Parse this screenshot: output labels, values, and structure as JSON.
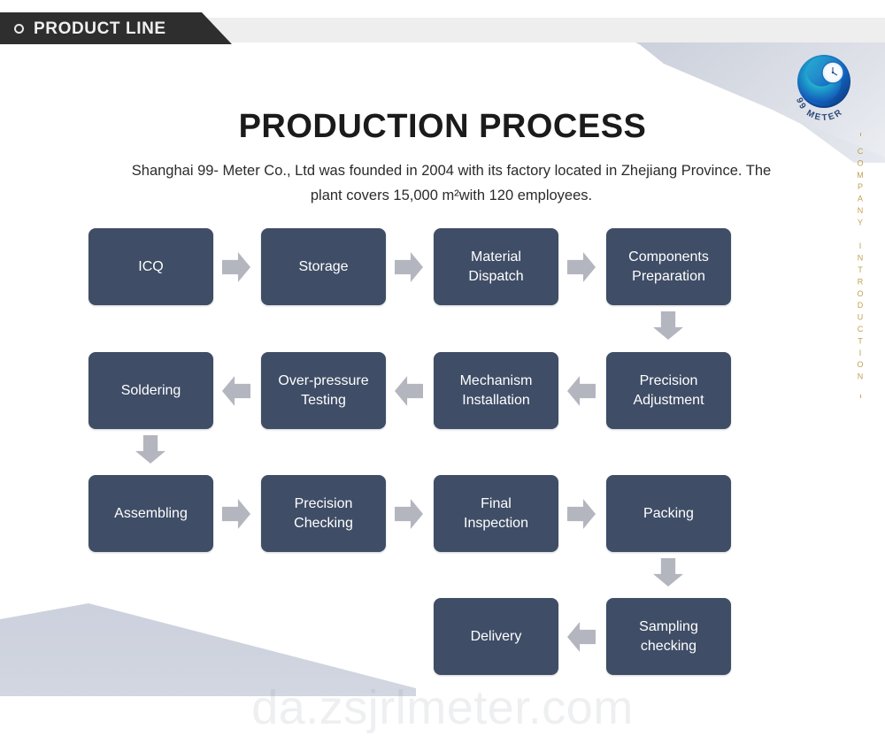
{
  "header": {
    "tab_label": "PRODUCT LINE",
    "bullet_icon": "circle-outline-icon"
  },
  "logo": {
    "name": "99-meter-logo",
    "brand_text": "99 METER",
    "colors": {
      "outer": "#1b63c4",
      "mid": "#1ea5c8",
      "inner": "#0e3f8f",
      "highlight": "#6fd8e6"
    }
  },
  "side_rail": {
    "vertical_text": "COMPANY INTRODUCTION",
    "color": "#c2a052"
  },
  "page_title": "PRODUCTION PROCESS",
  "subtitle": "Shanghai 99- Meter Co., Ltd was founded in 2004 with its factory located in Zhejiang Province. The plant covers 15,000 m²with 120 employees.",
  "colors": {
    "box_fill": "#3f4d66",
    "arrow_fill": "#b3b6bf",
    "header_dark": "#2e2e2e",
    "header_strip": "#eeeeee",
    "deco_blue_gray": "#ccd1dd",
    "accent_gold": "#c2a052"
  },
  "flow": {
    "rows": [
      {
        "direction": "right",
        "steps": [
          {
            "label": "ICQ"
          },
          {
            "label": "Storage"
          },
          {
            "label": "Material\nDispatch"
          },
          {
            "label": "Components\nPreparation"
          }
        ]
      },
      {
        "direction": "left",
        "steps": [
          {
            "label": "Soldering"
          },
          {
            "label": "Over-pressure\nTesting"
          },
          {
            "label": "Mechanism\nInstallation"
          },
          {
            "label": "Precision\nAdjustment"
          }
        ]
      },
      {
        "direction": "right",
        "steps": [
          {
            "label": "Assembling"
          },
          {
            "label": "Precision\nChecking"
          },
          {
            "label": "Final\nInspection"
          },
          {
            "label": "Packing"
          }
        ]
      },
      {
        "direction": "left",
        "steps": [
          {
            "label": "Delivery"
          },
          {
            "label": "Sampling\nchecking"
          }
        ]
      }
    ],
    "connectors": [
      {
        "name": "arrow-icq-to-storage",
        "type": "arrow-right"
      },
      {
        "name": "arrow-storage-to-material-dispatch",
        "type": "arrow-right"
      },
      {
        "name": "arrow-material-dispatch-to-components-preparation",
        "type": "arrow-right"
      },
      {
        "name": "arrow-components-preparation-to-precision-adjustment",
        "type": "arrow-down"
      },
      {
        "name": "arrow-precision-adjustment-to-mechanism-installation",
        "type": "arrow-left"
      },
      {
        "name": "arrow-mechanism-installation-to-over-pressure-testing",
        "type": "arrow-left"
      },
      {
        "name": "arrow-over-pressure-testing-to-soldering",
        "type": "arrow-left"
      },
      {
        "name": "arrow-soldering-to-assembling",
        "type": "arrow-down"
      },
      {
        "name": "arrow-assembling-to-precision-checking",
        "type": "arrow-right"
      },
      {
        "name": "arrow-precision-checking-to-final-inspection",
        "type": "arrow-right"
      },
      {
        "name": "arrow-final-inspection-to-packing",
        "type": "arrow-right"
      },
      {
        "name": "arrow-packing-to-sampling-checking",
        "type": "arrow-down"
      },
      {
        "name": "arrow-sampling-checking-to-delivery",
        "type": "arrow-left"
      }
    ]
  },
  "watermark": "da.zsjrlmeter.com"
}
